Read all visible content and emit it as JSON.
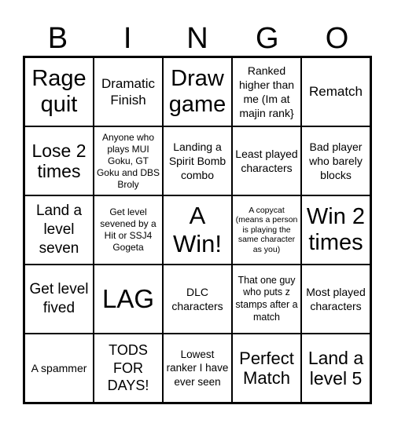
{
  "header": [
    "B",
    "I",
    "N",
    "G",
    "O"
  ],
  "cells": [
    "Rage quit",
    "Dramatic Finish",
    "Draw game",
    "Ranked higher than me (Im at majin rank}",
    "Rematch",
    "Lose 2 times",
    "Anyone who plays MUI Goku, GT Goku and DBS Broly",
    "Landing a Spirit Bomb combo",
    "Least played characters",
    "Bad player who barely blocks",
    "Land a level seven",
    "Get level sevened by a Hit or SSJ4 Gogeta",
    "A Win!",
    "A copycat (means a person is playing the same character as you)",
    "Win 2 times",
    "Get level fived",
    "LAG",
    "DLC characters",
    "That one guy who puts z stamps after a match",
    "Most played characters",
    "A spammer",
    "TODS FOR DAYS!",
    "Lowest ranker I have ever seen",
    "Perfect Match",
    "Land a level 5"
  ]
}
